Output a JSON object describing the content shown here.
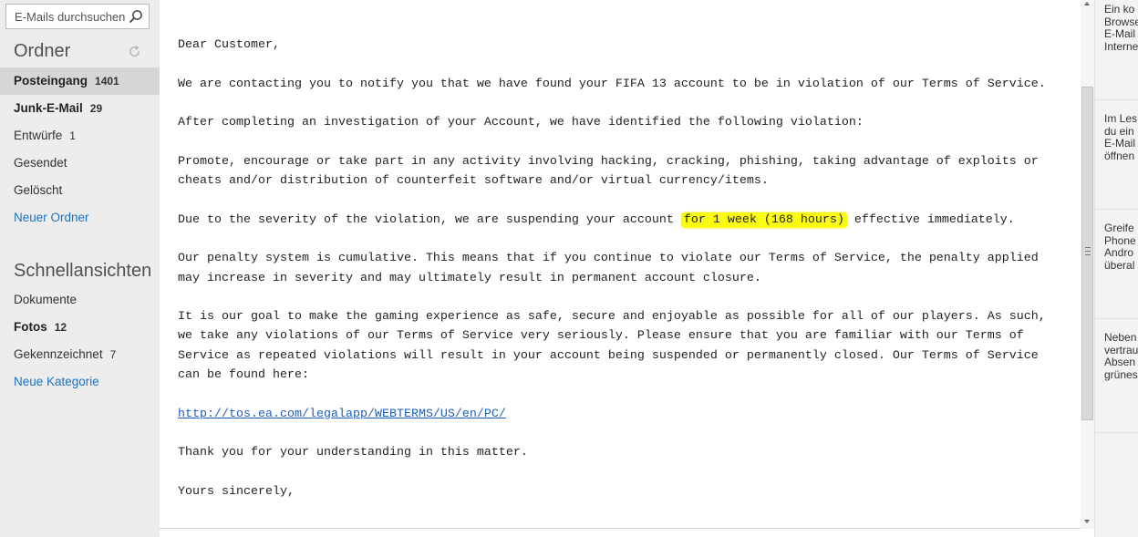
{
  "search": {
    "placeholder": "E-Mails durchsuchen"
  },
  "folders": {
    "title": "Ordner",
    "items": [
      {
        "label": "Posteingang",
        "count": "1401"
      },
      {
        "label": "Junk-E-Mail",
        "count": "29"
      },
      {
        "label": "Entwürfe",
        "count": "1"
      },
      {
        "label": "Gesendet",
        "count": ""
      },
      {
        "label": "Gelöscht",
        "count": ""
      }
    ],
    "new_label": "Neuer Ordner"
  },
  "quickviews": {
    "title": "Schnellansichten",
    "items": [
      {
        "label": "Dokumente",
        "count": ""
      },
      {
        "label": "Fotos",
        "count": "12"
      },
      {
        "label": "Gekennzeichnet",
        "count": "7"
      }
    ],
    "new_label": "Neue Kategorie"
  },
  "message": {
    "greeting": "Dear Customer,",
    "p1": "We are contacting you to notify you that we have found your FIFA 13 account to be in violation of our Terms of Service.",
    "p2": "After completing an investigation of your Account, we have identified the following violation:",
    "p3": "Promote, encourage or take part in any activity involving hacking, cracking, phishing, taking advantage of exploits or cheats and/or distribution of counterfeit software and/or virtual currency/items.",
    "p4_before": "Due to the severity of the violation, we are suspending your account ",
    "p4_highlight": "for 1 week (168 hours)",
    "p4_after": " effective immediately.",
    "p5": "Our penalty system is cumulative. This means that if you continue to violate our Terms of Service, the penalty applied may increase in severity and may ultimately result in permanent account closure.",
    "p6": "It is our goal to make the gaming experience as safe, secure and enjoyable as possible for all of our players. As such, we take any violations of our Terms of Service very seriously. Please ensure that you are familiar with our Terms of Service as repeated violations will result in your account being suspended or permanently closed. Our Terms of Service can be found here:",
    "link": "http://tos.ea.com/legalapp/WEBTERMS/US/en/PC/",
    "p7": "Thank you for your understanding in this matter.",
    "cut_line": "Yours sincerely,"
  },
  "ads": [
    {
      "lines": [
        "Ein ko",
        "Browse",
        "E-Mail",
        "Interne"
      ]
    },
    {
      "lines": [
        "Im Les",
        "du ein",
        "E-Mail",
        "öffnen"
      ]
    },
    {
      "lines": [
        "Greife",
        "Phone",
        "Andro",
        "überal"
      ]
    },
    {
      "lines": [
        "Neben",
        "vertrau",
        "Absen",
        "grünes"
      ]
    }
  ],
  "colors": {
    "sidebar_bg": "#ededed",
    "active_bg": "#d6d6d6",
    "link": "#1b72c2",
    "highlight": "#fcfc10"
  },
  "icons": {
    "search": "search-icon",
    "refresh": "refresh-icon"
  }
}
